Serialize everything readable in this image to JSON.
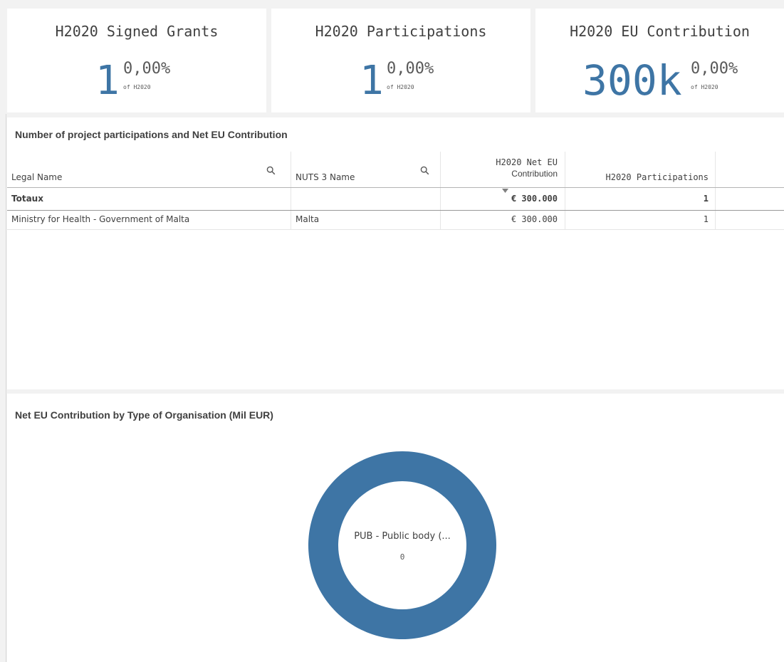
{
  "kpis": [
    {
      "title": "H2020 Signed Grants",
      "value": "1",
      "percent": "0,00%",
      "of_label": "of H2020"
    },
    {
      "title": "H2020 Participations",
      "value": "1",
      "percent": "0,00%",
      "of_label": "of H2020"
    },
    {
      "title": "H2020 EU Contribution",
      "value": "300k",
      "percent": "0,00%",
      "of_label": "of H2020"
    }
  ],
  "table_panel": {
    "title": "Number of project participations and Net EU Contribution",
    "columns": [
      "Legal Name",
      "NUTS 3 Name",
      "H2020 Net EU Contribution",
      "H2020 Participations"
    ],
    "column_lines": {
      "net_line1": "H2020 Net EU",
      "net_line2": "Contribution"
    },
    "totals": {
      "label": "Totaux",
      "contribution": "€ 300.000",
      "participations": "1"
    },
    "rows": [
      {
        "legal_name": "Ministry for Health - Government of Malta",
        "nuts3": "Malta",
        "contribution": "€ 300.000",
        "participations": "1"
      }
    ]
  },
  "chart_panel": {
    "title": "Net EU Contribution by Type of Organisation (Mil EUR)",
    "center_label": "PUB - Public body (...",
    "center_value": "0"
  },
  "colors": {
    "accent": "#3e75a5",
    "text": "#404040",
    "background": "#f2f2f2"
  },
  "chart_data": {
    "type": "pie",
    "donut": true,
    "title": "Net EU Contribution by Type of Organisation (Mil EUR)",
    "categories": [
      "PUB - Public body (..."
    ],
    "values": [
      0.3
    ],
    "colors": [
      "#3e75a5"
    ]
  }
}
